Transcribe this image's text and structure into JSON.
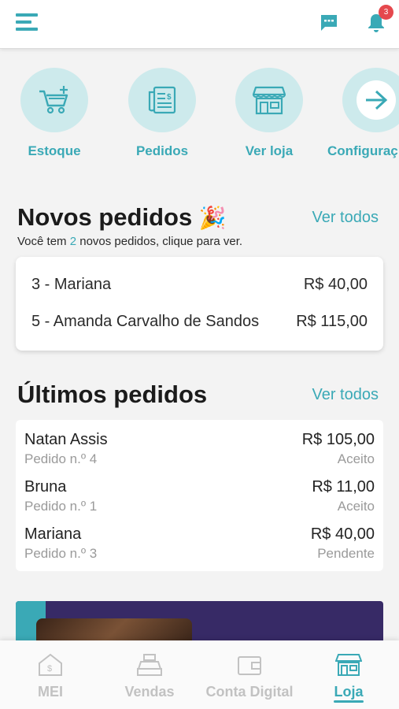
{
  "header": {
    "notification_count": "3"
  },
  "shortcuts": [
    {
      "label": "Estoque"
    },
    {
      "label": "Pedidos"
    },
    {
      "label": "Ver loja"
    },
    {
      "label": "Configuraç"
    }
  ],
  "new_orders": {
    "title": "Novos pedidos",
    "emoji": "🎉",
    "see_all": "Ver todos",
    "subtitle_prefix": "Você tem",
    "count": "2",
    "subtitle_suffix": "novos pedidos, clique para ver.",
    "items": [
      {
        "label": "3 - Mariana",
        "amount": "R$ 40,00"
      },
      {
        "label": "5 - Amanda Carvalho de Sandos",
        "amount": "R$ 115,00"
      }
    ]
  },
  "last_orders": {
    "title": "Últimos pedidos",
    "see_all": "Ver todos",
    "items": [
      {
        "name": "Natan Assis",
        "number": "Pedido n.º 4",
        "price": "R$ 105,00",
        "status": "Aceito"
      },
      {
        "name": "Bruna",
        "number": "Pedido n.º 1",
        "price": "R$ 11,00",
        "status": "Aceito"
      },
      {
        "name": "Mariana",
        "number": "Pedido n.º 3",
        "price": "R$ 40,00",
        "status": "Pendente"
      }
    ]
  },
  "bottom_nav": [
    {
      "label": "MEI"
    },
    {
      "label": "Vendas"
    },
    {
      "label": "Conta Digital"
    },
    {
      "label": "Loja",
      "active": true
    }
  ],
  "colors": {
    "accent": "#3aa9b6",
    "accent_light": "#cdeaec",
    "badge": "#e5484d",
    "banner": "#372a66"
  }
}
